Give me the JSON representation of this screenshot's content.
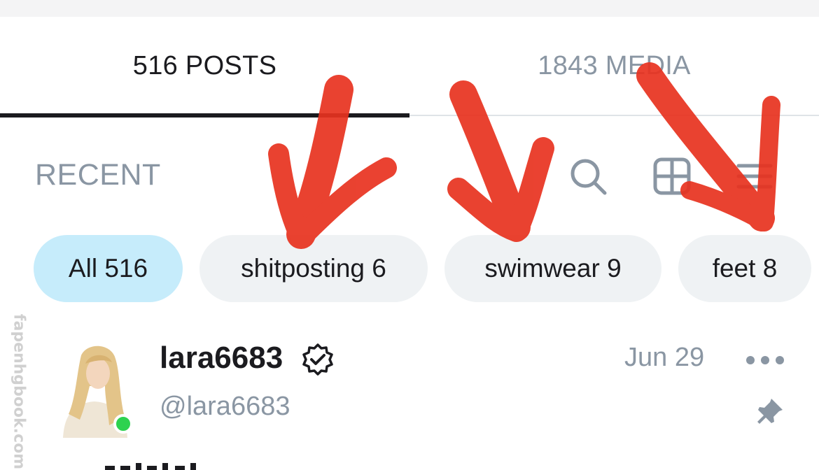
{
  "tabs": {
    "posts_label": "516 POSTS",
    "media_label": "1843 MEDIA"
  },
  "section": {
    "title": "RECENT"
  },
  "toolbar": {
    "icons": [
      "search-icon",
      "grid-icon",
      "list-icon"
    ]
  },
  "filters": [
    {
      "label": "All 516",
      "active": true
    },
    {
      "label": "shitposting 6",
      "active": false
    },
    {
      "label": "swimwear 9",
      "active": false
    },
    {
      "label": "feet 8",
      "active": false
    }
  ],
  "post": {
    "name": "lara6683",
    "handle": "@lara6683",
    "date": "Jun 29",
    "verified": true,
    "online": true
  },
  "watermark": "fapenhgbook.com",
  "colors": {
    "accent_chip": "#c6ecfb",
    "chip_bg": "#eff2f4",
    "muted_text": "#8a96a3",
    "online": "#2dd24f",
    "annotation_red": "#e8321f"
  }
}
